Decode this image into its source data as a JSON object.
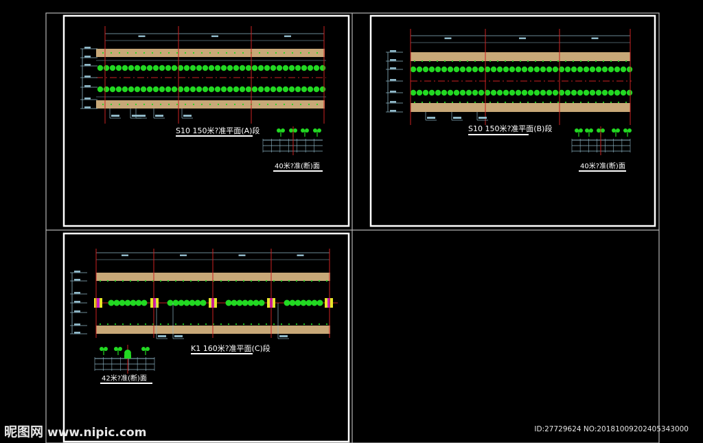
{
  "sheets": [
    {
      "title": "S10 150米?准平面(A)段",
      "detail_title": "40米?准(断)面"
    },
    {
      "title": "S10 150米?准平面(B)段",
      "detail_title": "40米?准(断)面"
    },
    {
      "title": "K1 160米?准平面(C)段",
      "detail_title": "42米?准(断)面"
    }
  ],
  "watermark": {
    "logo": "昵图网",
    "site": "www.nipic.com",
    "id_text": "ID:27729624 NO:20181009202405343000"
  },
  "colors": {
    "background": "#000000",
    "frame": "#ffffff",
    "border": "#b4b4b4",
    "band": "#c8a878",
    "plant": "#22d822",
    "axis": "#cc2222",
    "dim": "#8fb8c8",
    "accent": "#c81ec8",
    "flower": "#e6e628"
  }
}
